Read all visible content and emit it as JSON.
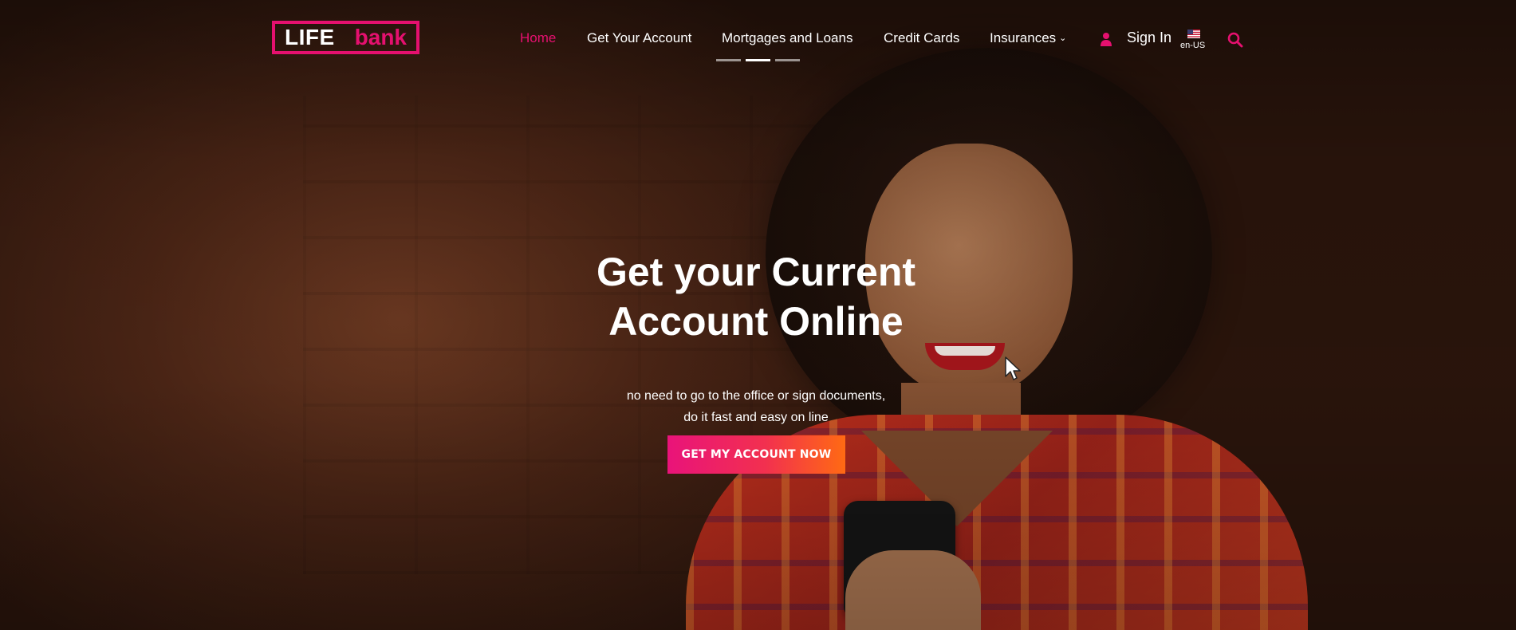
{
  "brand": {
    "logo_left": "LIFE",
    "logo_right": "bank",
    "accent": "#e5106f"
  },
  "nav": {
    "items": [
      {
        "label": "Home",
        "active": true
      },
      {
        "label": "Get Your Account"
      },
      {
        "label": "Mortgages and Loans"
      },
      {
        "label": "Credit Cards"
      },
      {
        "label": "Insurances",
        "dropdown": true
      }
    ],
    "sign_in": "Sign In",
    "language": "en-US"
  },
  "carousel": {
    "slides": 3,
    "active_slide": 2
  },
  "hero": {
    "title_line1": "Get your Current",
    "title_line2": "Account Online",
    "subtitle_line1": "no need to go to the office or sign documents,",
    "subtitle_line2": "do it fast and easy on line",
    "cta_label": "GET MY ACCOUNT NOW"
  },
  "icons": [
    "user-icon",
    "us-flag-icon",
    "search-icon",
    "chevron-down-icon",
    "mouse-cursor-icon"
  ]
}
